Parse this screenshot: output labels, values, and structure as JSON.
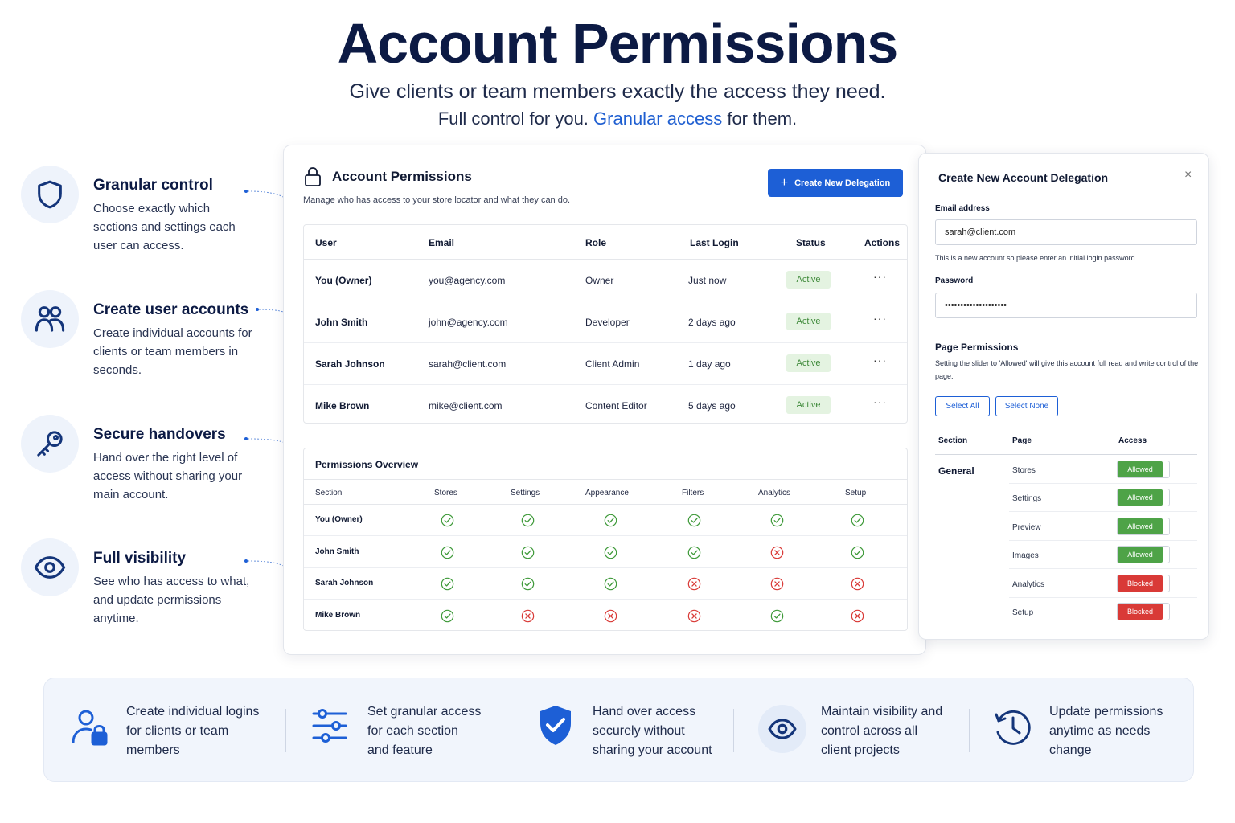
{
  "hero": {
    "title": "Account Permissions",
    "subtitle": "Give clients or team members exactly the access they need.",
    "tagline_prefix": "Full control for you. ",
    "tagline_accent": "Granular access",
    "tagline_suffix": " for them."
  },
  "features": [
    {
      "icon": "shield-icon",
      "title": "Granular control",
      "desc": "Choose exactly which sections and settings each user can access."
    },
    {
      "icon": "users-icon",
      "title": "Create user accounts",
      "desc": "Create individual accounts for clients or team members in seconds."
    },
    {
      "icon": "key-icon",
      "title": "Secure handovers",
      "desc": "Hand over the right level of access without sharing your main account."
    },
    {
      "icon": "eye-icon",
      "title": "Full visibility",
      "desc": "See who has access to what, and update permissions anytime."
    }
  ],
  "main_panel": {
    "title": "Account Permissions",
    "subtitle": "Manage who has access to your store locator and what they can do.",
    "create_button": "Create New Delegation",
    "columns": [
      "User",
      "Email",
      "Role",
      "Last Login",
      "Status",
      "Actions"
    ],
    "users": [
      {
        "user": "You (Owner)",
        "email": "you@agency.com",
        "role": "Owner",
        "last_login": "Just now",
        "status": "Active"
      },
      {
        "user": "John Smith",
        "email": "john@agency.com",
        "role": "Developer",
        "last_login": "2 days ago",
        "status": "Active"
      },
      {
        "user": "Sarah Johnson",
        "email": "sarah@client.com",
        "role": "Client Admin",
        "last_login": "1 day ago",
        "status": "Active"
      },
      {
        "user": "Mike Brown",
        "email": "mike@client.com",
        "role": "Content Editor",
        "last_login": "5 days ago",
        "status": "Active"
      }
    ],
    "actions_glyph": "···",
    "overview": {
      "title": "Permissions Overview",
      "columns": [
        "Section",
        "Stores",
        "Settings",
        "Appearance",
        "Filters",
        "Analytics",
        "Setup"
      ],
      "rows": [
        {
          "name": "You (Owner)",
          "values": [
            true,
            true,
            true,
            true,
            true,
            true
          ]
        },
        {
          "name": "John Smith",
          "values": [
            true,
            true,
            true,
            true,
            false,
            true
          ]
        },
        {
          "name": "Sarah Johnson",
          "values": [
            true,
            true,
            true,
            false,
            false,
            false
          ]
        },
        {
          "name": "Mike Brown",
          "values": [
            true,
            false,
            false,
            false,
            true,
            false
          ]
        }
      ]
    }
  },
  "modal": {
    "title": "Create New Account Delegation",
    "close": "×",
    "email_label": "Email address",
    "email_value": "sarah@client.com",
    "email_hint": "This is a new account so please enter an initial login password.",
    "password_label": "Password",
    "password_value": "••••••••••••••••••••",
    "permissions_title": "Page Permissions",
    "permissions_hint": "Setting the slider to 'Allowed' will give this account full read and write control of the page.",
    "select_all": "Select All",
    "select_none": "Select None",
    "columns": [
      "Section",
      "Page",
      "Access"
    ],
    "group": "General",
    "pages": [
      {
        "page": "Stores",
        "access": "Allowed"
      },
      {
        "page": "Settings",
        "access": "Allowed"
      },
      {
        "page": "Preview",
        "access": "Allowed"
      },
      {
        "page": "Images",
        "access": "Allowed"
      },
      {
        "page": "Analytics",
        "access": "Blocked"
      },
      {
        "page": "Setup",
        "access": "Blocked"
      }
    ]
  },
  "strip": [
    {
      "icon": "user-lock-icon",
      "text": [
        "Create individual logins",
        "for clients or team",
        "members"
      ]
    },
    {
      "icon": "sliders-icon",
      "text": [
        "Set granular access",
        "for each section",
        "and feature"
      ]
    },
    {
      "icon": "shield-check-icon",
      "text": [
        "Hand over access",
        "securely without",
        "sharing your account"
      ]
    },
    {
      "icon": "eye-icon",
      "text": [
        "Maintain visibility and",
        "control across all",
        "client projects"
      ]
    },
    {
      "icon": "history-icon",
      "text": [
        "Update permissions",
        "anytime as needs",
        "change"
      ]
    }
  ],
  "colors": {
    "navy": "#0c1a44",
    "accent": "#1d5fd6",
    "allowed": "#4ea347",
    "blocked": "#d93a37",
    "active_bg": "#e4f3e1",
    "active_text": "#3f8a3a"
  }
}
